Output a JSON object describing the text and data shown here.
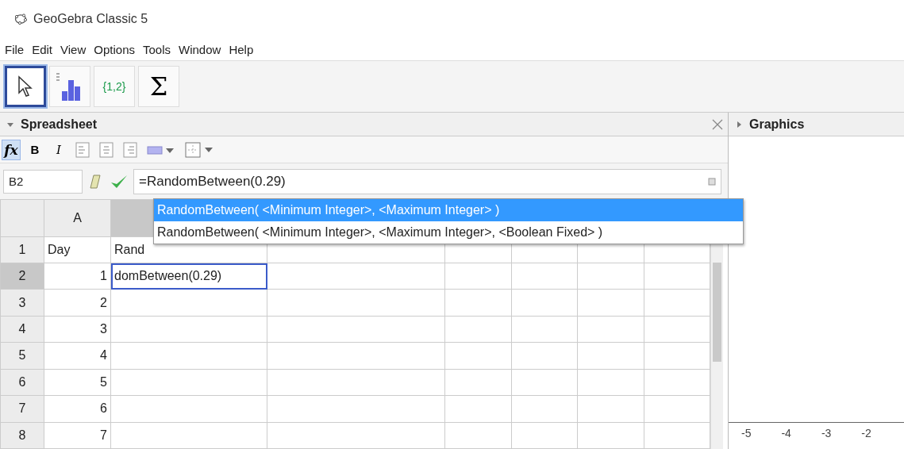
{
  "window": {
    "title": "GeoGebra Classic 5"
  },
  "menu": [
    "File",
    "Edit",
    "View",
    "Options",
    "Tools",
    "Window",
    "Help"
  ],
  "toolbar": [
    {
      "kind": "move",
      "selected": true
    },
    {
      "kind": "chart",
      "selected": false
    },
    {
      "kind": "list",
      "label": "{1,2}",
      "selected": false
    },
    {
      "kind": "sum",
      "label": "Σ",
      "selected": false
    }
  ],
  "spreadsheet": {
    "title": "Spreadsheet",
    "expanded": true,
    "format_tools": [
      {
        "kind": "fx",
        "label": "fx",
        "selected": true
      },
      {
        "kind": "bold",
        "label": "B",
        "selected": false
      },
      {
        "kind": "italic",
        "label": "I",
        "selected": false
      },
      {
        "kind": "align-left",
        "selected": false
      },
      {
        "kind": "align-center",
        "selected": false
      },
      {
        "kind": "align-right",
        "selected": false
      },
      {
        "kind": "color",
        "selected": false
      },
      {
        "kind": "border",
        "selected": false
      }
    ],
    "cell_name": "B2",
    "input": "=RandomBetween(0.29)",
    "columns": [
      {
        "label": "A",
        "selected": false
      },
      {
        "selected": true
      }
    ],
    "rows": [
      {
        "number": "1",
        "selected": false,
        "cells": {
          "A": "Day",
          "B": "Rand"
        }
      },
      {
        "number": "2",
        "selected": true,
        "cells": {
          "A": "1",
          "B": "domBetween(0.29)"
        }
      },
      {
        "number": "3",
        "selected": false,
        "cells": {
          "A": "2"
        }
      },
      {
        "number": "4",
        "selected": false,
        "cells": {
          "A": "3"
        }
      },
      {
        "number": "5",
        "selected": false,
        "cells": {
          "A": "4"
        }
      },
      {
        "number": "6",
        "selected": false,
        "cells": {
          "A": "5"
        }
      },
      {
        "number": "7",
        "selected": false,
        "cells": {
          "A": "6"
        }
      },
      {
        "number": "8",
        "selected": false,
        "cells": {
          "A": "7"
        }
      }
    ],
    "suggestions": [
      {
        "text": "RandomBetween( <Minimum Integer>, <Maximum Integer> )",
        "selected": true
      },
      {
        "text": "RandomBetween( <Minimum Integer>, <Maximum Integer>, <Boolean Fixed> )",
        "selected": false
      }
    ]
  },
  "graphics": {
    "title": "Graphics",
    "expanded": false,
    "x_axis_labels": [
      "-5",
      "-4",
      "-3",
      "-2"
    ]
  }
}
